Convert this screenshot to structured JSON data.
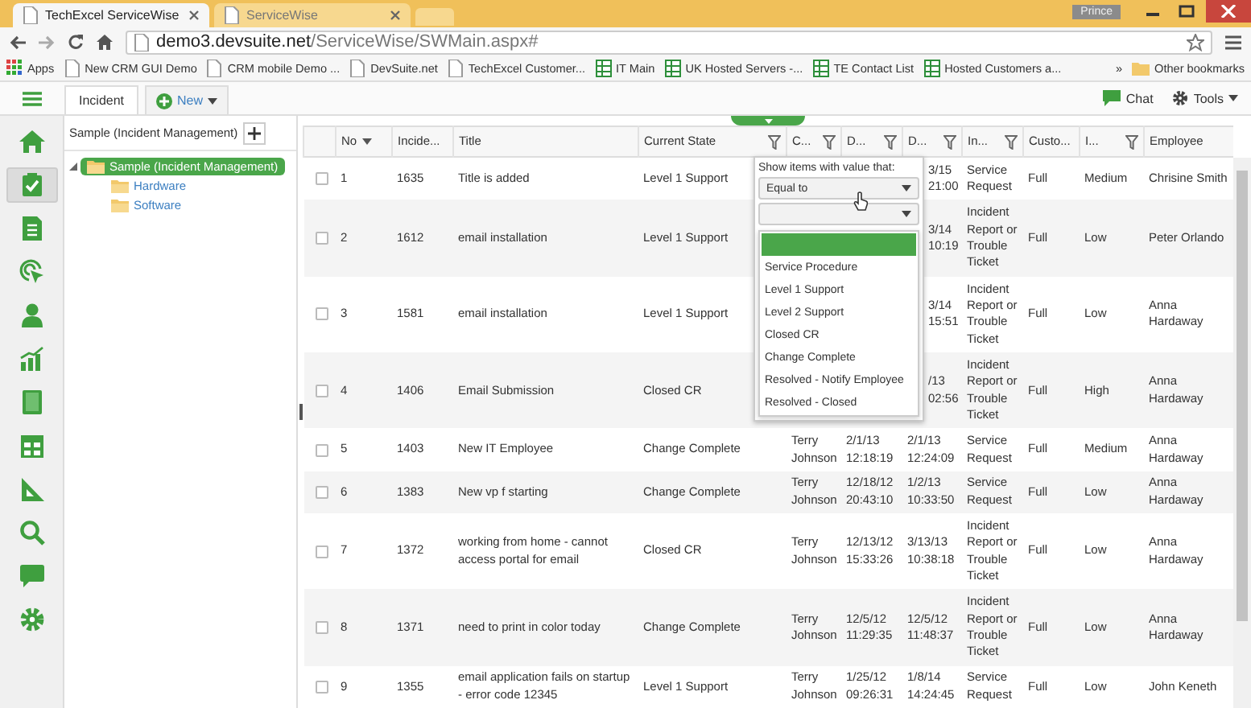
{
  "browser": {
    "tabs": [
      {
        "title": "TechExcel ServiceWise",
        "selected": true
      },
      {
        "title": "ServiceWise",
        "selected": false
      }
    ],
    "profile": "Prince",
    "url_host": "demo3.devsuite.net",
    "url_path": "/ServiceWise/SWMain.aspx#",
    "bookmarks": [
      {
        "kind": "apps",
        "label": "Apps"
      },
      {
        "kind": "page",
        "label": "New CRM GUI Demo"
      },
      {
        "kind": "page",
        "label": "CRM mobile Demo ..."
      },
      {
        "kind": "page",
        "label": "DevSuite.net"
      },
      {
        "kind": "page",
        "label": "TechExcel Customer..."
      },
      {
        "kind": "sheet",
        "label": "IT Main"
      },
      {
        "kind": "sheet",
        "label": "UK Hosted Servers -..."
      },
      {
        "kind": "sheet",
        "label": "TE Contact List"
      },
      {
        "kind": "sheet",
        "label": "Hosted Customers a..."
      }
    ],
    "overflow": "»",
    "other_bookmarks": "Other bookmarks"
  },
  "app": {
    "tabs": [
      {
        "kind": "tab",
        "label": "Incident",
        "selected": true
      },
      {
        "kind": "new",
        "label": "New",
        "selected": false
      }
    ],
    "chat": "Chat",
    "tools": "Tools"
  },
  "rail": [
    {
      "selected": false
    },
    {
      "selected": true
    },
    {
      "selected": false
    },
    {
      "selected": false
    },
    {
      "selected": false
    },
    {
      "selected": false
    },
    {
      "selected": false
    },
    {
      "selected": false
    },
    {
      "selected": false
    },
    {
      "selected": false
    },
    {
      "selected": false
    },
    {
      "selected": false
    }
  ],
  "tree": {
    "title": "Sample (Incident Management)",
    "root": {
      "label": "Sample (Incident Management)",
      "selected": true,
      "expanded": true,
      "children": [
        {
          "label": "Hardware",
          "selected": false
        },
        {
          "label": "Software",
          "selected": false
        }
      ]
    }
  },
  "table": {
    "columns": [
      {
        "label": "No",
        "sorted": true,
        "filter": false
      },
      {
        "label": "Incide...",
        "filter": false
      },
      {
        "label": "Title",
        "filter": false
      },
      {
        "label": "Current State",
        "filter": true
      },
      {
        "label": "C...",
        "filter": true
      },
      {
        "label": "D...",
        "filter": true
      },
      {
        "label": "D...",
        "filter": true
      },
      {
        "label": "In...",
        "filter": true
      },
      {
        "label": "Custo...",
        "filter": false
      },
      {
        "label": "I...",
        "filter": true
      },
      {
        "label": "Employee",
        "filter": false
      }
    ],
    "rows": [
      {
        "checked": false,
        "cells": [
          "1",
          "1635",
          "Title is added",
          "Level 1 Support",
          null,
          null,
          "3/15 21:00",
          "Service Request",
          "Full",
          "Medium",
          "Chrisine Smith"
        ]
      },
      {
        "checked": false,
        "cells": [
          "2",
          "1612",
          "email installation",
          "Level 1 Support",
          null,
          null,
          "3/14 10:19",
          "Incident Report or Trouble Ticket",
          "Full",
          "Low",
          "Peter Orlando"
        ]
      },
      {
        "checked": false,
        "cells": [
          "3",
          "1581",
          "email installation",
          "Level 1 Support",
          null,
          null,
          "3/14 15:51",
          "Incident Report or Trouble Ticket",
          "Full",
          "Low",
          "Anna Hardaway"
        ]
      },
      {
        "checked": false,
        "cells": [
          "4",
          "1406",
          "Email Submission",
          "Closed CR",
          null,
          null,
          "/13 02:56",
          "Incident Report or Trouble Ticket",
          "Full",
          "High",
          "Anna Hardaway"
        ]
      },
      {
        "checked": false,
        "cells": [
          "5",
          "1403",
          "New IT Employee",
          "Change Complete",
          "Terry Johnson",
          "2/1/13 12:18:19",
          "2/1/13 12:24:09",
          "Service Request",
          "Full",
          "Medium",
          "Anna Hardaway"
        ]
      },
      {
        "checked": false,
        "cells": [
          "6",
          "1383",
          "New vp f starting",
          "Change Complete",
          "Terry Johnson",
          "12/18/12 20:43:10",
          "1/2/13 10:33:50",
          "Service Request",
          "Full",
          "Low",
          "Anna Hardaway"
        ]
      },
      {
        "checked": false,
        "cells": [
          "7",
          "1372",
          "working from home - cannot access portal for email",
          "Closed CR",
          "Terry Johnson",
          "12/13/12 15:33:26",
          "3/13/13 10:38:18",
          "Incident Report or Trouble Ticket",
          "Full",
          "Low",
          "Anna Hardaway"
        ]
      },
      {
        "checked": false,
        "cells": [
          "8",
          "1371",
          "need to print in color today",
          "Change Complete",
          "Terry Johnson",
          "12/5/12 11:29:35",
          "12/5/12 11:48:37",
          "Incident Report or Trouble Ticket",
          "Full",
          "Low",
          "Anna Hardaway"
        ]
      },
      {
        "checked": false,
        "cells": [
          "9",
          "1355",
          "email application fails on startup - error code 12345",
          "Level 1 Support",
          "Terry Johnson",
          "1/25/12 09:26:31",
          "1/8/14 14:24:45",
          "Service Request",
          "Full",
          "Low",
          "John Keneth"
        ]
      }
    ]
  },
  "filter_popup": {
    "prompt": "Show items with value that:",
    "operator": "Equal to",
    "blank_option_selected": true,
    "options": [
      "Service Procedure",
      "Level 1 Support",
      "Level 2 Support",
      "Closed CR",
      "Change Complete",
      "Resolved - Notify Employee",
      "Resolved - Closed"
    ]
  }
}
